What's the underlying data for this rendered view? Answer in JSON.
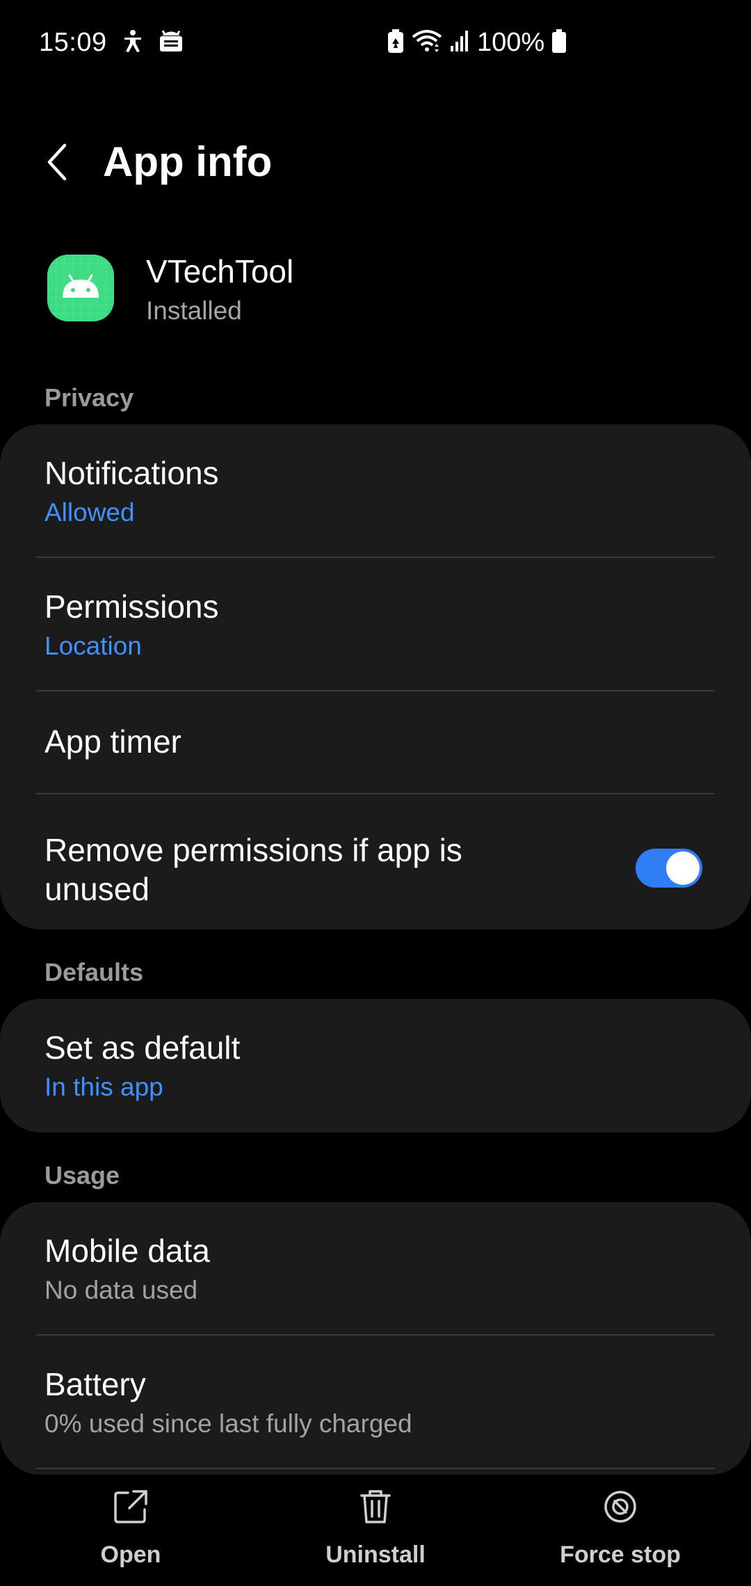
{
  "status_bar": {
    "time": "15:09",
    "battery_text": "100%",
    "icons": [
      "accessibility-icon",
      "android-debug-icon",
      "battery-saver-icon",
      "wifi-icon",
      "signal-icon",
      "battery-icon"
    ]
  },
  "header": {
    "back_icon": "chevron-left-icon",
    "title": "App info"
  },
  "app": {
    "name": "VTechTool",
    "status": "Installed",
    "icon": "android-app-icon",
    "icon_color": "#3ddc84"
  },
  "sections": {
    "privacy": {
      "heading": "Privacy",
      "items": [
        {
          "title": "Notifications",
          "subtitle": "Allowed"
        },
        {
          "title": "Permissions",
          "subtitle": "Location"
        },
        {
          "title": "App timer"
        },
        {
          "title": "Remove permissions if app is unused",
          "toggle_on": true
        }
      ]
    },
    "defaults": {
      "heading": "Defaults",
      "items": [
        {
          "title": "Set as default",
          "subtitle": "In this app"
        }
      ]
    },
    "usage": {
      "heading": "Usage",
      "items": [
        {
          "title": "Mobile data",
          "subtitle": "No data used"
        },
        {
          "title": "Battery",
          "subtitle": "0% used since last fully charged"
        }
      ]
    }
  },
  "bottom_actions": [
    {
      "label": "Open",
      "icon": "open-external-icon"
    },
    {
      "label": "Uninstall",
      "icon": "trash-icon"
    },
    {
      "label": "Force stop",
      "icon": "force-stop-icon"
    }
  ],
  "colors": {
    "accent": "#3e91ff",
    "toggle_on": "#2f7ef6",
    "card": "#1b1b1b",
    "background": "#000000"
  }
}
